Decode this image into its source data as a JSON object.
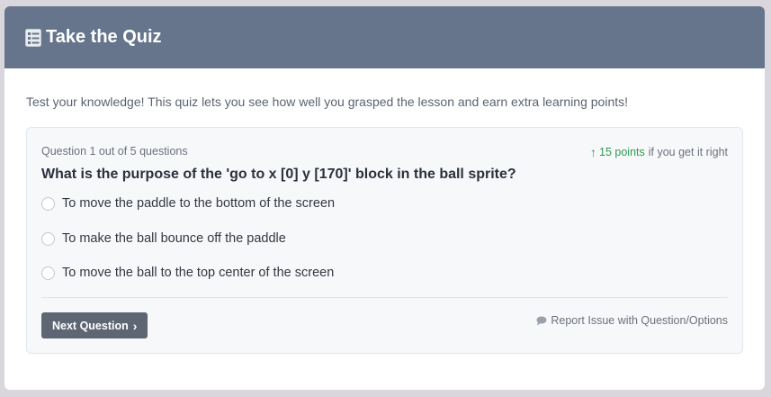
{
  "header": {
    "title": "Take the Quiz",
    "icon": "checklist-icon"
  },
  "intro": "Test your knowledge! This quiz lets you see how well you grasped the lesson and earn extra learning points!",
  "quiz": {
    "progress": "Question 1 out of 5 questions",
    "points_value": "15 points",
    "points_suffix": "if you get it right",
    "question": "What is the purpose of the 'go to x [0] y [170]' block in the ball sprite?",
    "options": [
      "To move the paddle to the bottom of the screen",
      "To make the ball bounce off the paddle",
      "To move the ball to the top center of the screen"
    ],
    "next_label": "Next Question",
    "report_label": "Report Issue with Question/Options"
  },
  "colors": {
    "header": "#66758c",
    "accent_green": "#2f9a4e",
    "button": "#5e6673"
  }
}
